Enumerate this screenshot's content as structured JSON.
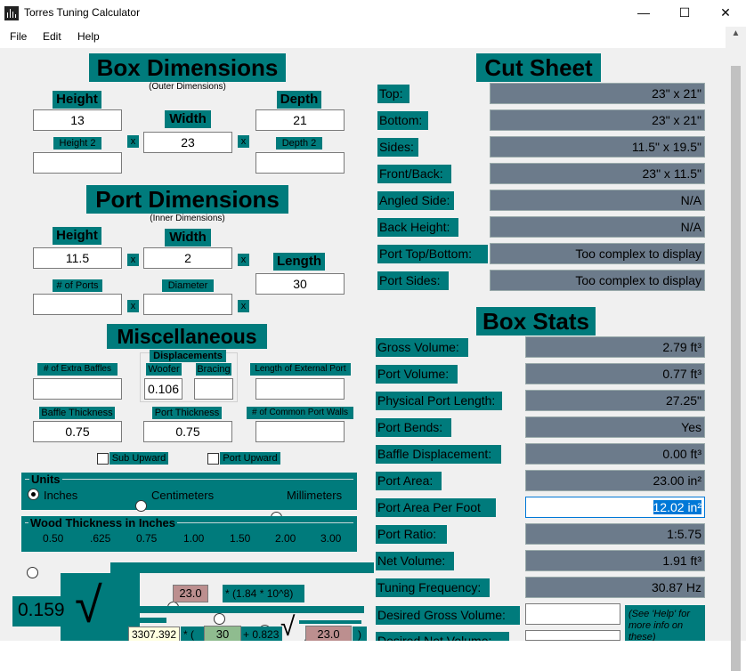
{
  "window": {
    "title": "Torres Tuning Calculator",
    "minimize": "—",
    "maximize": "☐",
    "close": "✕"
  },
  "menu": {
    "file": "File",
    "edit": "Edit",
    "help": "Help"
  },
  "box": {
    "title": "Box Dimensions",
    "subtitle": "(Outer Dimensions)",
    "height_label": "Height",
    "width_label": "Width",
    "depth_label": "Depth",
    "height2_label": "Height 2",
    "depth2_label": "Depth 2",
    "height": "13",
    "width": "23",
    "depth": "21",
    "height2": "",
    "depth2": "",
    "x": "x"
  },
  "port": {
    "title": "Port Dimensions",
    "subtitle": "(Inner Dimensions)",
    "height_label": "Height",
    "width_label": "Width",
    "length_label": "Length",
    "ports_label": "# of Ports",
    "diameter_label": "Diameter",
    "height": "11.5",
    "width": "2",
    "length": "30",
    "ports": "",
    "diameter": ""
  },
  "misc": {
    "title": "Miscellaneous",
    "displacements": "Displacements",
    "extra_baffles_label": "# of Extra Baffles",
    "woofer_label": "Woofer",
    "bracing_label": "Bracing",
    "ext_port_label": "Length of External Port",
    "baffle_thickness_label": "Baffle Thickness",
    "port_thickness_label": "Port Thickness",
    "common_walls_label": "# of Common Port Walls",
    "woofer": "0.106",
    "baffle_thickness": "0.75",
    "port_thickness": "0.75",
    "sub_upward": "Sub Upward",
    "port_upward": "Port Upward"
  },
  "units": {
    "title": "Units",
    "inches": "Inches",
    "centimeters": "Centimeters",
    "millimeters": "Millimeters",
    "selected": "Inches"
  },
  "wood": {
    "title": "Wood Thickness in Inches",
    "options": [
      "0.50",
      ".625",
      "0.75",
      "1.00",
      "1.50",
      "2.00",
      "3.00"
    ],
    "selected": "0.75"
  },
  "formula": {
    "coef": "0.159",
    "val1": "23.0",
    "mult": "* (1.84 * 10^8)",
    "val2": "3307.392",
    "p1": "* (",
    "val3": "30",
    "p2": "+ 0.823",
    "val4": "23.0",
    "p3": ")"
  },
  "cut": {
    "title": "Cut Sheet",
    "rows": [
      {
        "label": "Top:",
        "value": "23\" x 21\""
      },
      {
        "label": "Bottom:",
        "value": "23\" x 21\""
      },
      {
        "label": "Sides:",
        "value": "11.5\" x 19.5\""
      },
      {
        "label": "Front/Back:",
        "value": "23\" x 11.5\""
      },
      {
        "label": "Angled Side:",
        "value": "N/A"
      },
      {
        "label": "Back Height:",
        "value": "N/A"
      },
      {
        "label": "Port Top/Bottom:",
        "value": "Too complex to display"
      },
      {
        "label": "Port Sides:",
        "value": "Too complex to display"
      }
    ]
  },
  "stats": {
    "title": "Box Stats",
    "rows": [
      {
        "label": "Gross Volume:",
        "value": "2.79 ft³"
      },
      {
        "label": "Port Volume:",
        "value": "0.77 ft³"
      },
      {
        "label": "Physical Port Length:",
        "value": "27.25\""
      },
      {
        "label": "Port Bends:",
        "value": "Yes"
      },
      {
        "label": "Baffle Displacement:",
        "value": "0.00 ft³"
      },
      {
        "label": "Port Area:",
        "value": "23.00 in²"
      },
      {
        "label": "Port Area Per Foot",
        "value": "12.02 in²"
      },
      {
        "label": "Port Ratio:",
        "value": "1:5.75"
      },
      {
        "label": "Net Volume:",
        "value": "1.91 ft³"
      },
      {
        "label": "Tuning Frequency:",
        "value": "30.87 Hz"
      }
    ],
    "desired_gross": "Desired Gross Volume:",
    "desired_net": "Desired Net Volume:",
    "help_note": "(See 'Help' for more info on these)"
  },
  "colors": {
    "teal": "#007b7c",
    "slate": "#6c7b8b",
    "selection": "#0078d7"
  }
}
